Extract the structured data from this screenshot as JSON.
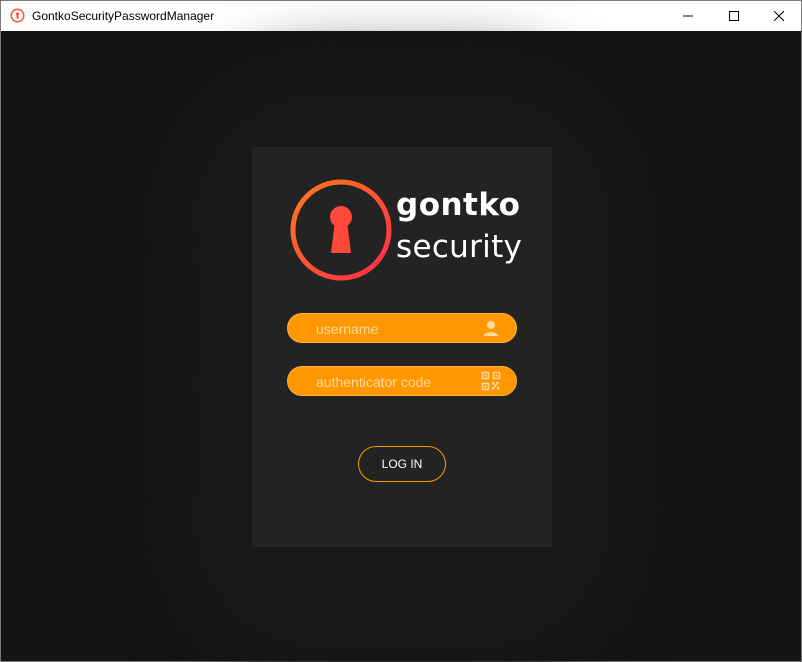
{
  "window": {
    "title": "GontkoSecurityPasswordManager",
    "controls": {
      "minimize": "minimize",
      "maximize": "maximize",
      "close": "close"
    }
  },
  "login": {
    "brand_top": "gontko",
    "brand_bottom": "security",
    "username": {
      "value": "",
      "placeholder": "username",
      "icon": "user-icon"
    },
    "code": {
      "value": "",
      "placeholder": "authenticator code",
      "icon": "qr-code-icon"
    },
    "button_label": "LOG IN",
    "logo_icon": "keyhole-icon"
  },
  "colors": {
    "accent": "#ff9800",
    "logo_gradient_start": "#ff7a1a",
    "logo_gradient_end": "#ff2b4a",
    "card_background": "#232323",
    "window_background": "#141414"
  }
}
